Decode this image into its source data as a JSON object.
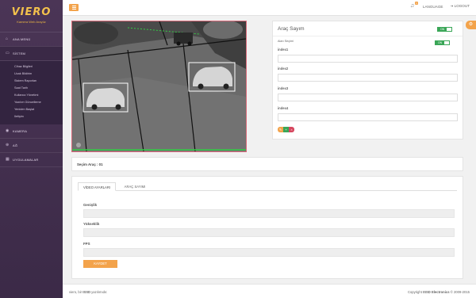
{
  "brand": {
    "logo": "VIERO",
    "tagline": "Kamera Web Arayüz"
  },
  "sidebar": {
    "items": [
      {
        "label": "ANA MENÜ",
        "icon": "home-icon"
      },
      {
        "label": "SİSTEM",
        "icon": "monitor-icon"
      },
      {
        "label": "KAMERA",
        "icon": "camera-icon"
      },
      {
        "label": "AĞ",
        "icon": "network-icon"
      },
      {
        "label": "UYGULAMALAR",
        "icon": "apps-icon"
      }
    ],
    "submenu": [
      "Cihaz Bilgileri",
      "Ucak Bildirim",
      "Sistem Raporları",
      "Saat Tarih",
      "Kullanıcı Yönetimi",
      "Yazılım Güncelleme",
      "Yeniden Başlat",
      "Iletişim"
    ]
  },
  "topbar": {
    "notification_count": "1",
    "language": "LANGUAGE",
    "logout": "LOGOUT"
  },
  "panel": {
    "title": "Araç Sayım",
    "toggle_on": "ON",
    "alan_label": "Alan Seçimi",
    "index_labels": [
      "index1",
      "index2",
      "index3",
      "index4"
    ]
  },
  "selected": {
    "text": "Seçim Araç : 01"
  },
  "tabs": [
    "VİDEO AYARLARI",
    "ARAÇ SAYIMI"
  ],
  "form": {
    "fields": [
      "Genişlik",
      "Yükseklik",
      "FPS"
    ],
    "save": "KAYDET"
  },
  "footer": {
    "left_pre": "viero, bir ",
    "left_brand": "ISSD",
    "left_post": " yazılımıdır.",
    "right_pre": "Copyright ",
    "right_brand": "ISSD Electronics",
    "right_post": " © 2009-2015"
  },
  "colors": {
    "accent": "#f3a34b",
    "sidebar": "#4b3556",
    "toggle": "#3aa657",
    "btn_red": "#e2584c",
    "btn_green": "#3aa657",
    "btn_pink": "#d6475f"
  }
}
